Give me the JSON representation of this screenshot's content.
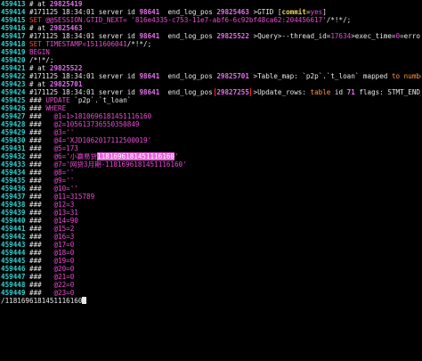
{
  "lines": [
    [
      [
        "459413 ",
        "ln"
      ],
      [
        "# at ",
        "w"
      ],
      [
        "29825419",
        "num"
      ]
    ],
    [
      [
        "459414 ",
        "ln"
      ],
      [
        "#171125 18:34:01 server id ",
        "w"
      ],
      [
        "98641",
        "num"
      ],
      [
        "  end_log_pos ",
        "w"
      ],
      [
        "29825463",
        "num"
      ],
      [
        " >GTID [",
        "w"
      ],
      [
        "commit",
        "yellow"
      ],
      [
        "=",
        "w"
      ],
      [
        "yes",
        "pink"
      ],
      [
        "]",
        "w"
      ]
    ],
    [
      [
        "459415 ",
        "ln"
      ],
      [
        "SET ",
        "red"
      ],
      [
        "@@SESSION.GTID_NEXT=",
        "pink"
      ],
      [
        " '816e4335-c753-11e7-abf6-6c92bf48ca62:204456617'",
        "pink"
      ],
      [
        "/*!*/;",
        "w"
      ]
    ],
    [
      [
        "459416 ",
        "ln"
      ],
      [
        "# at ",
        "w"
      ],
      [
        "29825463",
        "num"
      ]
    ],
    [
      [
        "459417 ",
        "ln"
      ],
      [
        "#171125 18:34:01 server id ",
        "w"
      ],
      [
        "98641",
        "num"
      ],
      [
        "  end_log_pos ",
        "w"
      ],
      [
        "29825522",
        "num"
      ],
      [
        " >Query>--thread_id=",
        "w"
      ],
      [
        "17634",
        "pink"
      ],
      [
        ">exec_time=",
        "w"
      ],
      [
        "0",
        "pink"
      ],
      [
        "=error_code=",
        "w"
      ],
      [
        "0",
        "pink"
      ]
    ],
    [
      [
        "459418 ",
        "ln"
      ],
      [
        "SET ",
        "red"
      ],
      [
        "TIMESTAMP=1511606041",
        "pink"
      ],
      [
        "/*!*/;",
        "w"
      ]
    ],
    [
      [
        "459419 ",
        "ln"
      ],
      [
        "BEGIN",
        "pink"
      ]
    ],
    [
      [
        "459420 ",
        "ln"
      ],
      [
        "/*!*/;",
        "w"
      ]
    ],
    [
      [
        "459421 ",
        "ln"
      ],
      [
        "# at ",
        "w"
      ],
      [
        "29825522",
        "num"
      ]
    ],
    [
      [
        "459422 ",
        "ln"
      ],
      [
        "#171125 18:34:01 server id ",
        "w"
      ],
      [
        "98641",
        "num"
      ],
      [
        "  end_log_pos ",
        "w"
      ],
      [
        "29825701",
        "num"
      ],
      [
        " >Table_map: `p2p`.`t_loan` mapped ",
        "w"
      ],
      [
        "to",
        "orange"
      ],
      [
        " ",
        "w"
      ],
      [
        "number",
        "orange"
      ],
      [
        " ",
        "w"
      ],
      [
        "71",
        "num"
      ]
    ],
    [
      [
        "459423 ",
        "ln"
      ],
      [
        "# at ",
        "w"
      ],
      [
        "29825701",
        "num"
      ]
    ],
    [
      [
        "459424 ",
        "ln"
      ],
      [
        "#171125 18:34:01 server id ",
        "w"
      ],
      [
        "98641",
        "num"
      ],
      [
        "  end_log_pos ",
        "w"
      ],
      [
        "29827255",
        "num box"
      ],
      [
        " >Update_rows: ",
        "w"
      ],
      [
        "table",
        "orange"
      ],
      [
        " id ",
        "w"
      ],
      [
        "71",
        "num"
      ],
      [
        " flags: STMT_END_F",
        "w"
      ]
    ],
    [
      [
        "459425 ",
        "ln"
      ],
      [
        "### ",
        "w"
      ],
      [
        "UPDATE ",
        "pink"
      ],
      [
        "`p2p`.`t_loan`",
        "w"
      ]
    ],
    [
      [
        "459426 ",
        "ln"
      ],
      [
        "### ",
        "w"
      ],
      [
        "WHERE",
        "pink"
      ]
    ],
    [
      [
        "459427 ",
        "ln"
      ],
      [
        "###   ",
        "w"
      ],
      [
        "@1=1>1810696181451116160",
        "pink"
      ]
    ],
    [
      [
        "459428 ",
        "ln"
      ],
      [
        "###   ",
        "w"
      ],
      [
        "@2=105613736550350849",
        "pink"
      ]
    ],
    [
      [
        "459429 ",
        "ln"
      ],
      [
        "###   ",
        "w"
      ],
      [
        "@3=''",
        "pink"
      ]
    ],
    [
      [
        "459430 ",
        "ln"
      ],
      [
        "###   ",
        "w"
      ],
      [
        "@4='XJD1062017112500019'",
        "pink"
      ]
    ],
    [
      [
        "459431 ",
        "ln"
      ],
      [
        "###   ",
        "w"
      ],
      [
        "@5=173",
        "pink"
      ]
    ],
    [
      [
        "459432 ",
        "ln"
      ],
      [
        "###   ",
        "w"
      ],
      [
        "@6='小赢易贷",
        "pink"
      ],
      [
        "1181696181451116160",
        "hl"
      ],
      [
        "'",
        "pink"
      ]
    ],
    [
      [
        "459433 ",
        "ln"
      ],
      [
        "###   ",
        "w"
      ],
      [
        "@7='网贷3月期-1181696181451116160'",
        "pink"
      ]
    ],
    [
      [
        "459434 ",
        "ln"
      ],
      [
        "###   ",
        "w"
      ],
      [
        "@8=''",
        "pink"
      ]
    ],
    [
      [
        "459435 ",
        "ln"
      ],
      [
        "###   ",
        "w"
      ],
      [
        "@9=''",
        "pink"
      ]
    ],
    [
      [
        "459436 ",
        "ln"
      ],
      [
        "###   ",
        "w"
      ],
      [
        "@10=''",
        "pink"
      ]
    ],
    [
      [
        "459437 ",
        "ln"
      ],
      [
        "###   ",
        "w"
      ],
      [
        "@11=315789",
        "pink"
      ]
    ],
    [
      [
        "459438 ",
        "ln"
      ],
      [
        "###   ",
        "w"
      ],
      [
        "@12=3",
        "pink"
      ]
    ],
    [
      [
        "459439 ",
        "ln"
      ],
      [
        "###   ",
        "w"
      ],
      [
        "@13=31",
        "pink"
      ]
    ],
    [
      [
        "459440 ",
        "ln"
      ],
      [
        "###   ",
        "w"
      ],
      [
        "@14=90",
        "pink"
      ]
    ],
    [
      [
        "459441 ",
        "ln"
      ],
      [
        "###   ",
        "w"
      ],
      [
        "@15=2",
        "pink"
      ]
    ],
    [
      [
        "459442 ",
        "ln"
      ],
      [
        "###   ",
        "w"
      ],
      [
        "@16=3",
        "pink"
      ]
    ],
    [
      [
        "459443 ",
        "ln"
      ],
      [
        "###   ",
        "w"
      ],
      [
        "@17=0",
        "pink"
      ]
    ],
    [
      [
        "459444 ",
        "ln"
      ],
      [
        "###   ",
        "w"
      ],
      [
        "@18=0",
        "pink"
      ]
    ],
    [
      [
        "459445 ",
        "ln"
      ],
      [
        "###   ",
        "w"
      ],
      [
        "@19=0",
        "pink"
      ]
    ],
    [
      [
        "459446 ",
        "ln"
      ],
      [
        "###   ",
        "w"
      ],
      [
        "@20=0",
        "pink"
      ]
    ],
    [
      [
        "459447 ",
        "ln"
      ],
      [
        "###   ",
        "w"
      ],
      [
        "@21=0",
        "pink"
      ]
    ],
    [
      [
        "459448 ",
        "ln"
      ],
      [
        "###   ",
        "w"
      ],
      [
        "@22=0",
        "pink"
      ]
    ],
    [
      [
        "459449 ",
        "ln"
      ],
      [
        "###   ",
        "w"
      ],
      [
        "@23=0",
        "pink"
      ]
    ]
  ],
  "command_line": "/1181696181451116160"
}
